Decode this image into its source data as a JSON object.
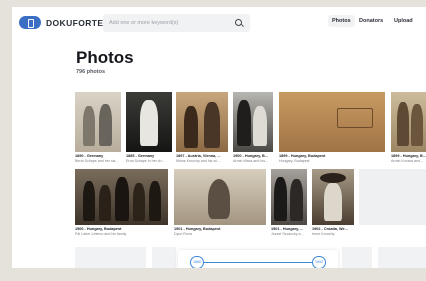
{
  "header": {
    "brand": "DOKUFORTE",
    "search_placeholder": "Add one or more keyword(s)",
    "nav": [
      "Photos",
      "Donators",
      "Upload"
    ]
  },
  "main": {
    "title": "Photos",
    "count": "796 photos"
  },
  "photos": [
    {
      "line1": "1890 - Germany",
      "line2": "Berta Schape and her sis..."
    },
    {
      "line1": "1885 - Germany",
      "line2": "Erna Schape in her ch..."
    },
    {
      "line1": "1897 - Austria, Vienna, ...",
      "line2": "Minos Krouchy and his wi..."
    },
    {
      "line1": "1900 - Hungary, B...",
      "line2": "Armin Waxa and his..."
    },
    {
      "line1": "1899 - Hungary, Budapest",
      "line2": "Hungary, Budapest"
    },
    {
      "line1": "1899 - Hungary, B...",
      "line2": "Armin Kovacs and..."
    },
    {
      "line1": "1900 - Hungary, Budapest",
      "line2": "Pál Laber-Lelemo and his family"
    },
    {
      "line1": "1901 - Hungary, Budapest",
      "line2": "Dyuri Rona"
    },
    {
      "line1": "1901 - Hungary, ...",
      "line2": "Jozsef Szczucky a..."
    },
    {
      "line1": "1902 - Croatia, We...",
      "line2": "Irene Krouchy"
    }
  ],
  "slider": {
    "start": "1880",
    "end": "1992"
  }
}
